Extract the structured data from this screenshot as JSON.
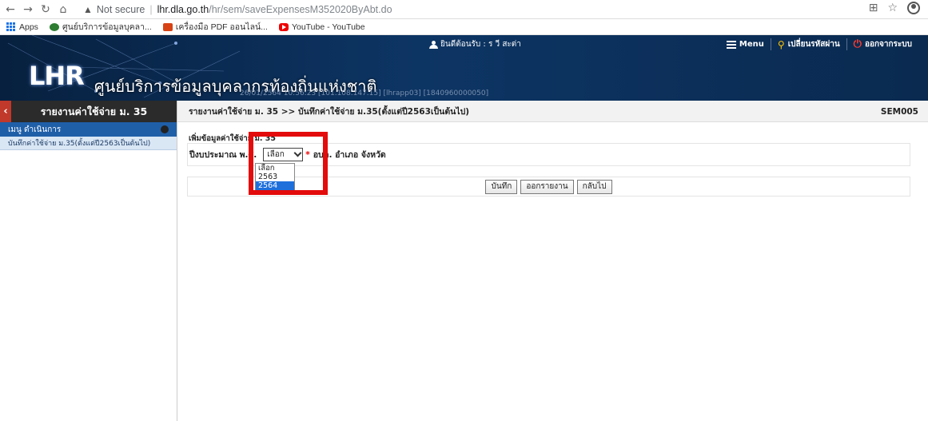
{
  "browser": {
    "not_secure": "Not secure",
    "url_host": "lhr.dla.go.th",
    "url_path": "/hr/sem/saveExpensesM352020ByAbt.do",
    "icons": [
      "back-arrow-icon",
      "forward-arrow-icon",
      "reload-icon",
      "home-icon",
      "warning-icon",
      "translate-icon",
      "star-icon",
      "profile-icon"
    ]
  },
  "bookmarks": [
    {
      "label": "Apps",
      "icon": "apps-icon"
    },
    {
      "label": "ศูนย์บริการข้อมูลบุคลา...",
      "icon": "site-icon"
    },
    {
      "label": "เครื่องมือ PDF ออนไลน์...",
      "icon": "pdf-icon"
    },
    {
      "label": "YouTube - YouTube",
      "icon": "youtube-icon"
    }
  ],
  "header": {
    "logo": "LHR",
    "site_title": "ศูนย์บริการข้อมูลบุคลากรท้องถิ่นแห่งชาติ",
    "session_info": "26/01/2564 10:56:23 [101.108.147.15] [lhrapp03] [1840960000050]",
    "welcome": "ยินดีต้อนรับ : ร วี สะต่า",
    "menu": "Menu",
    "change_password": "เปลี่ยนรหัสผ่าน",
    "logout": "ออกจากระบบ"
  },
  "sidebar": {
    "title": "รายงานค่าใช้จ่าย ม. 35",
    "group": "เมนู ดำเนินการ",
    "items": [
      "บันทึกค่าใช้จ่าย ม.35(ตั้งแต่ปี2563เป็นต้นไป)"
    ]
  },
  "main": {
    "breadcrumb": "รายงานค่าใช้จ่าย ม. 35 >> บันทึกค่าใช้จ่าย ม.35(ตั้งแต่ปี2563เป็นต้นไป)",
    "screen_code": "SEM005",
    "form_heading": "เพิ่มข้อมูลค่าใช้จ่าย ม. 35",
    "year_label": "ปีงบประมาณ พ.ศ.",
    "year_selected": "เลือก",
    "required_mark": "*",
    "org_text": "อบต. อำเภอ จังหวัด",
    "year_options": [
      "เลือก",
      "2563",
      "2564"
    ],
    "highlighted_option": "2564",
    "buttons": {
      "save": "บันทึก",
      "report": "ออกรายงาน",
      "back": "กลับไป"
    }
  },
  "colors": {
    "header_bg": "#0d3564",
    "sidebar_group": "#1f5fa8",
    "highlight": "#e30b0b",
    "selected_option": "#1e6fdc"
  }
}
